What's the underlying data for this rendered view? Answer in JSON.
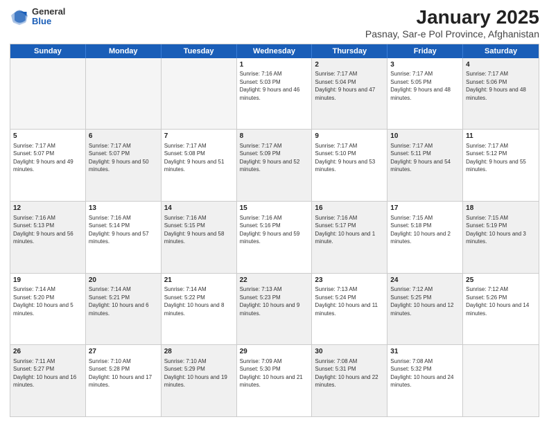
{
  "logo": {
    "general": "General",
    "blue": "Blue"
  },
  "title": "January 2025",
  "subtitle": "Pasnay, Sar-e Pol Province, Afghanistan",
  "days": [
    "Sunday",
    "Monday",
    "Tuesday",
    "Wednesday",
    "Thursday",
    "Friday",
    "Saturday"
  ],
  "weeks": [
    [
      {
        "day": "",
        "text": "",
        "empty": true,
        "shaded": false
      },
      {
        "day": "",
        "text": "",
        "empty": true,
        "shaded": false
      },
      {
        "day": "",
        "text": "",
        "empty": true,
        "shaded": false
      },
      {
        "day": "1",
        "text": "Sunrise: 7:16 AM\nSunset: 5:03 PM\nDaylight: 9 hours and 46 minutes.",
        "empty": false,
        "shaded": false
      },
      {
        "day": "2",
        "text": "Sunrise: 7:17 AM\nSunset: 5:04 PM\nDaylight: 9 hours and 47 minutes.",
        "empty": false,
        "shaded": true
      },
      {
        "day": "3",
        "text": "Sunrise: 7:17 AM\nSunset: 5:05 PM\nDaylight: 9 hours and 48 minutes.",
        "empty": false,
        "shaded": false
      },
      {
        "day": "4",
        "text": "Sunrise: 7:17 AM\nSunset: 5:06 PM\nDaylight: 9 hours and 48 minutes.",
        "empty": false,
        "shaded": true
      }
    ],
    [
      {
        "day": "5",
        "text": "Sunrise: 7:17 AM\nSunset: 5:07 PM\nDaylight: 9 hours and 49 minutes.",
        "empty": false,
        "shaded": false
      },
      {
        "day": "6",
        "text": "Sunrise: 7:17 AM\nSunset: 5:07 PM\nDaylight: 9 hours and 50 minutes.",
        "empty": false,
        "shaded": true
      },
      {
        "day": "7",
        "text": "Sunrise: 7:17 AM\nSunset: 5:08 PM\nDaylight: 9 hours and 51 minutes.",
        "empty": false,
        "shaded": false
      },
      {
        "day": "8",
        "text": "Sunrise: 7:17 AM\nSunset: 5:09 PM\nDaylight: 9 hours and 52 minutes.",
        "empty": false,
        "shaded": true
      },
      {
        "day": "9",
        "text": "Sunrise: 7:17 AM\nSunset: 5:10 PM\nDaylight: 9 hours and 53 minutes.",
        "empty": false,
        "shaded": false
      },
      {
        "day": "10",
        "text": "Sunrise: 7:17 AM\nSunset: 5:11 PM\nDaylight: 9 hours and 54 minutes.",
        "empty": false,
        "shaded": true
      },
      {
        "day": "11",
        "text": "Sunrise: 7:17 AM\nSunset: 5:12 PM\nDaylight: 9 hours and 55 minutes.",
        "empty": false,
        "shaded": false
      }
    ],
    [
      {
        "day": "12",
        "text": "Sunrise: 7:16 AM\nSunset: 5:13 PM\nDaylight: 9 hours and 56 minutes.",
        "empty": false,
        "shaded": true
      },
      {
        "day": "13",
        "text": "Sunrise: 7:16 AM\nSunset: 5:14 PM\nDaylight: 9 hours and 57 minutes.",
        "empty": false,
        "shaded": false
      },
      {
        "day": "14",
        "text": "Sunrise: 7:16 AM\nSunset: 5:15 PM\nDaylight: 9 hours and 58 minutes.",
        "empty": false,
        "shaded": true
      },
      {
        "day": "15",
        "text": "Sunrise: 7:16 AM\nSunset: 5:16 PM\nDaylight: 9 hours and 59 minutes.",
        "empty": false,
        "shaded": false
      },
      {
        "day": "16",
        "text": "Sunrise: 7:16 AM\nSunset: 5:17 PM\nDaylight: 10 hours and 1 minute.",
        "empty": false,
        "shaded": true
      },
      {
        "day": "17",
        "text": "Sunrise: 7:15 AM\nSunset: 5:18 PM\nDaylight: 10 hours and 2 minutes.",
        "empty": false,
        "shaded": false
      },
      {
        "day": "18",
        "text": "Sunrise: 7:15 AM\nSunset: 5:19 PM\nDaylight: 10 hours and 3 minutes.",
        "empty": false,
        "shaded": true
      }
    ],
    [
      {
        "day": "19",
        "text": "Sunrise: 7:14 AM\nSunset: 5:20 PM\nDaylight: 10 hours and 5 minutes.",
        "empty": false,
        "shaded": false
      },
      {
        "day": "20",
        "text": "Sunrise: 7:14 AM\nSunset: 5:21 PM\nDaylight: 10 hours and 6 minutes.",
        "empty": false,
        "shaded": true
      },
      {
        "day": "21",
        "text": "Sunrise: 7:14 AM\nSunset: 5:22 PM\nDaylight: 10 hours and 8 minutes.",
        "empty": false,
        "shaded": false
      },
      {
        "day": "22",
        "text": "Sunrise: 7:13 AM\nSunset: 5:23 PM\nDaylight: 10 hours and 9 minutes.",
        "empty": false,
        "shaded": true
      },
      {
        "day": "23",
        "text": "Sunrise: 7:13 AM\nSunset: 5:24 PM\nDaylight: 10 hours and 11 minutes.",
        "empty": false,
        "shaded": false
      },
      {
        "day": "24",
        "text": "Sunrise: 7:12 AM\nSunset: 5:25 PM\nDaylight: 10 hours and 12 minutes.",
        "empty": false,
        "shaded": true
      },
      {
        "day": "25",
        "text": "Sunrise: 7:12 AM\nSunset: 5:26 PM\nDaylight: 10 hours and 14 minutes.",
        "empty": false,
        "shaded": false
      }
    ],
    [
      {
        "day": "26",
        "text": "Sunrise: 7:11 AM\nSunset: 5:27 PM\nDaylight: 10 hours and 16 minutes.",
        "empty": false,
        "shaded": true
      },
      {
        "day": "27",
        "text": "Sunrise: 7:10 AM\nSunset: 5:28 PM\nDaylight: 10 hours and 17 minutes.",
        "empty": false,
        "shaded": false
      },
      {
        "day": "28",
        "text": "Sunrise: 7:10 AM\nSunset: 5:29 PM\nDaylight: 10 hours and 19 minutes.",
        "empty": false,
        "shaded": true
      },
      {
        "day": "29",
        "text": "Sunrise: 7:09 AM\nSunset: 5:30 PM\nDaylight: 10 hours and 21 minutes.",
        "empty": false,
        "shaded": false
      },
      {
        "day": "30",
        "text": "Sunrise: 7:08 AM\nSunset: 5:31 PM\nDaylight: 10 hours and 22 minutes.",
        "empty": false,
        "shaded": true
      },
      {
        "day": "31",
        "text": "Sunrise: 7:08 AM\nSunset: 5:32 PM\nDaylight: 10 hours and 24 minutes.",
        "empty": false,
        "shaded": false
      },
      {
        "day": "",
        "text": "",
        "empty": true,
        "shaded": false
      }
    ]
  ]
}
